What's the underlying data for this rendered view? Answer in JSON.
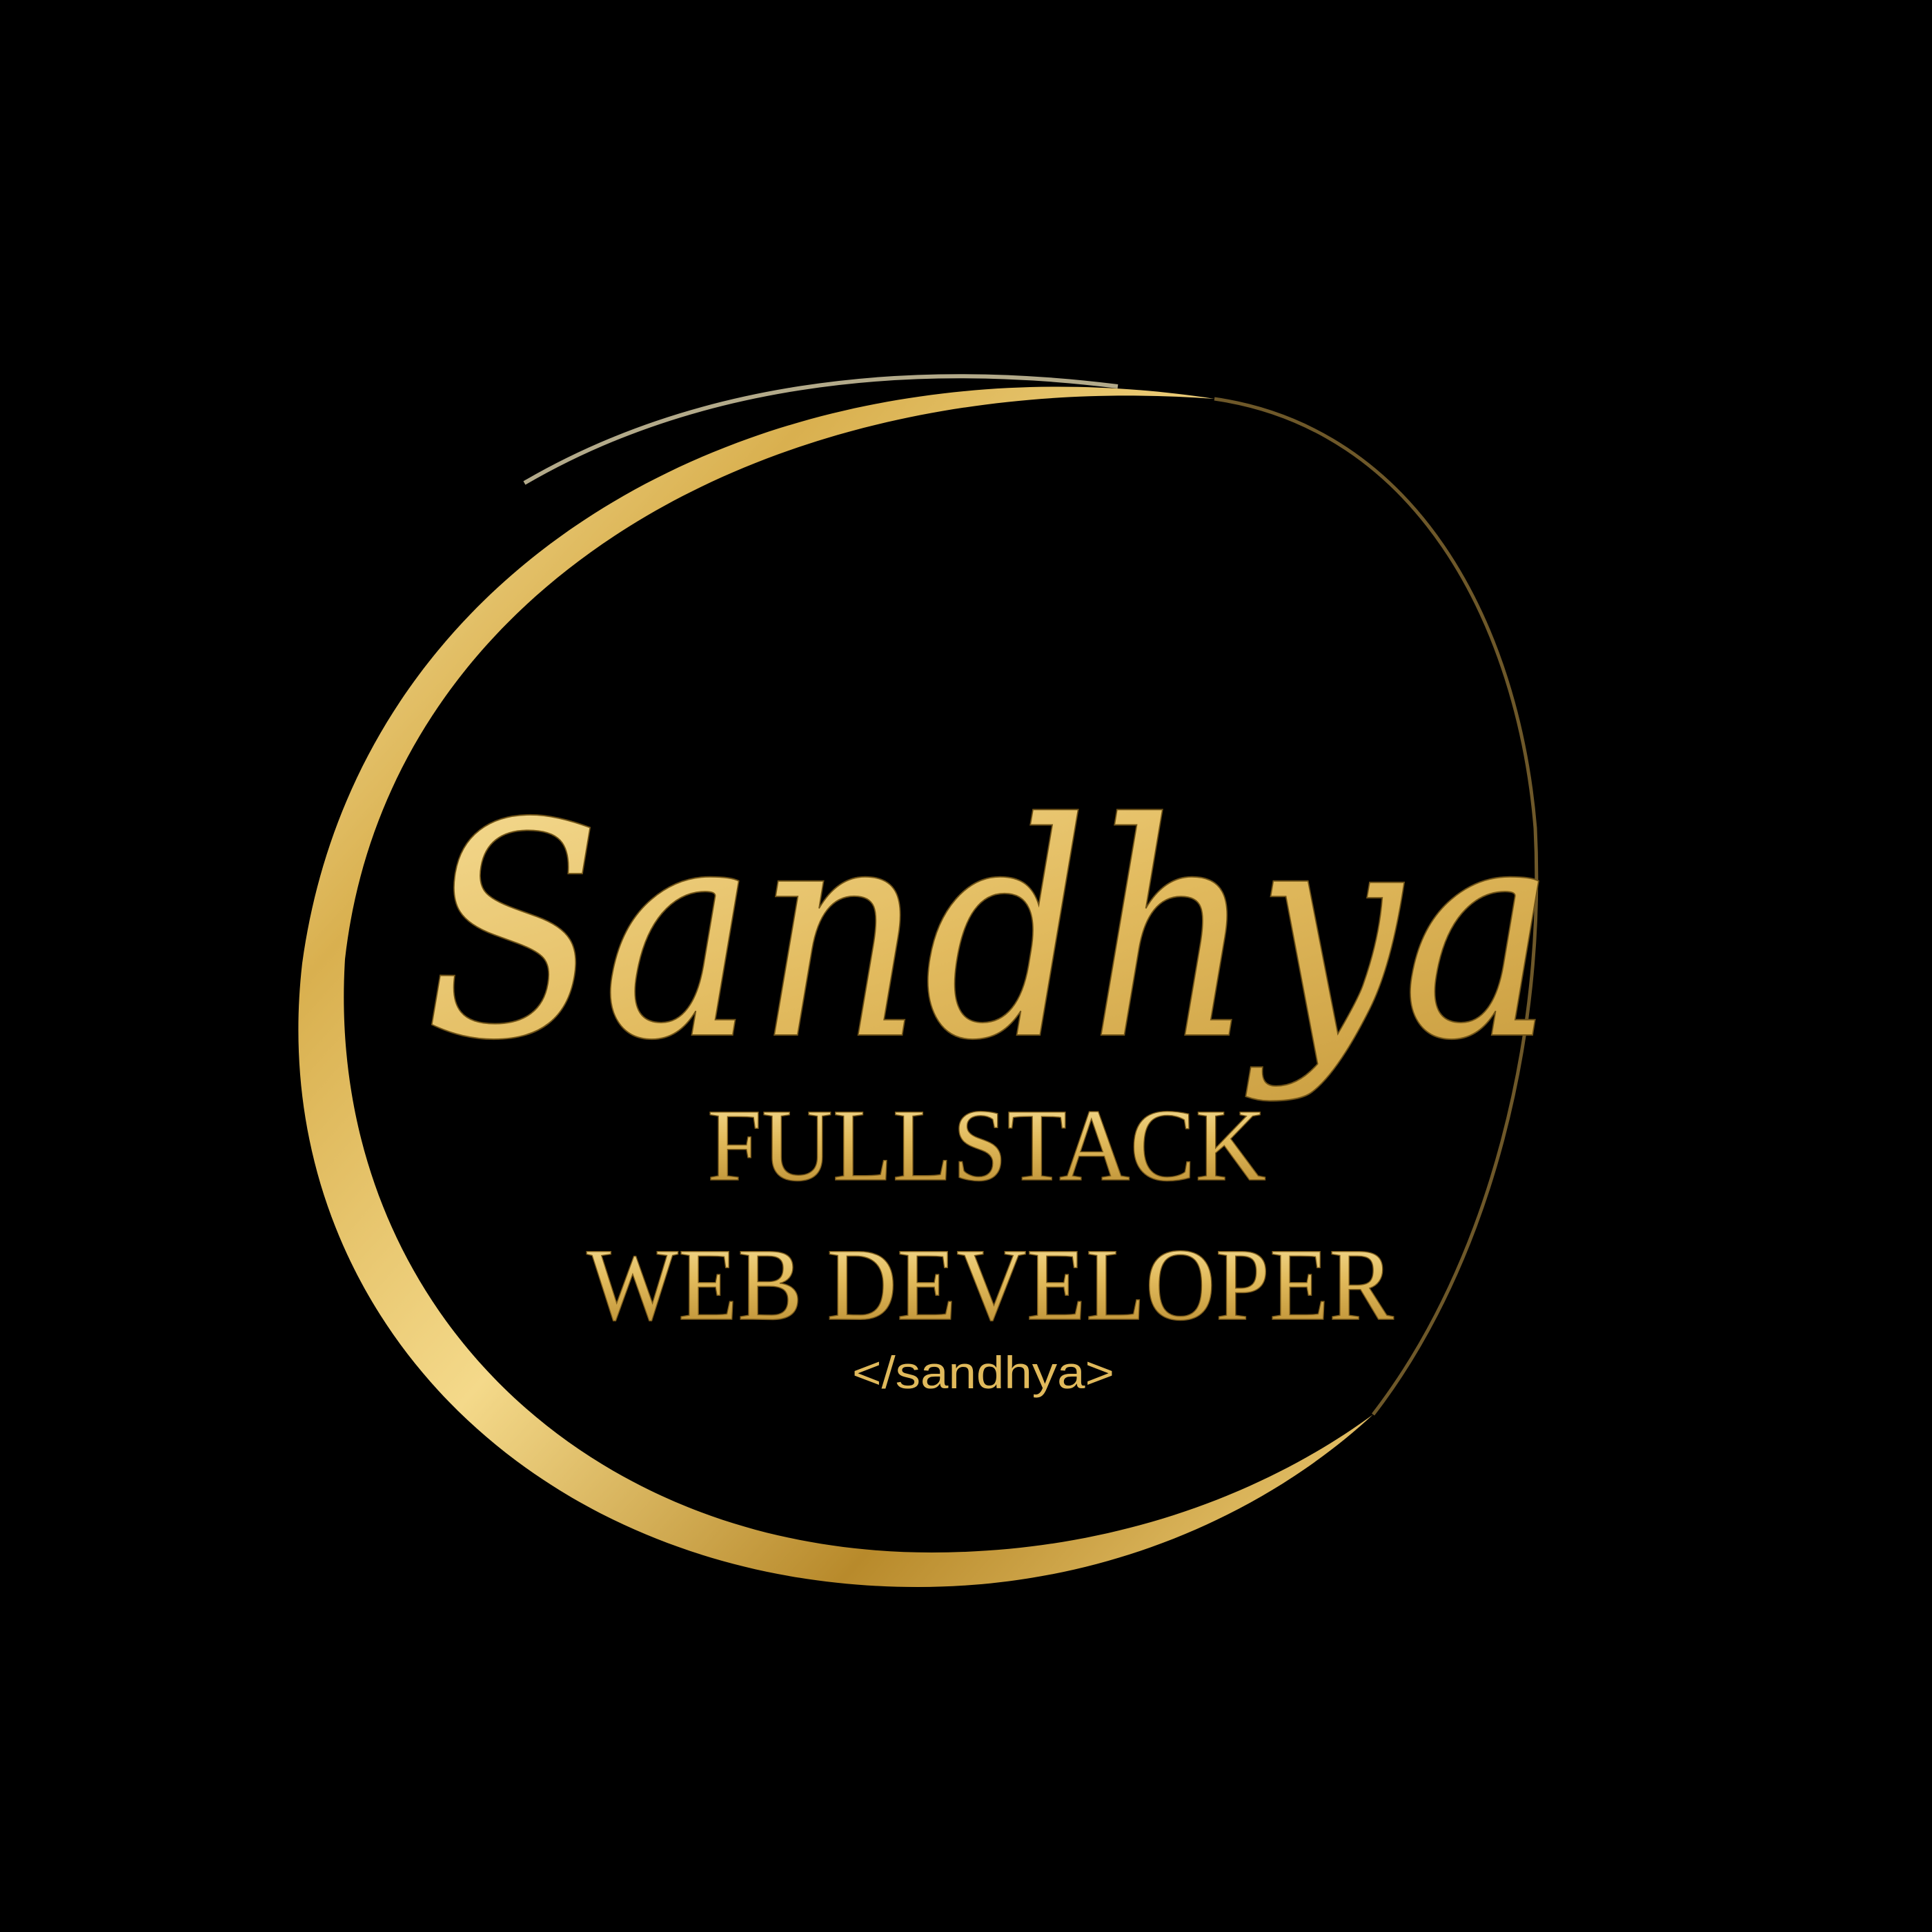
{
  "logo": {
    "script_name": "Sandhya",
    "title_line1": "FULLSTACK",
    "title_line2": "WEB DEVELOPER",
    "code_tag": "</sandhya>"
  },
  "colors": {
    "background": "#000000",
    "gold_light": "#f6dd8f",
    "gold_mid": "#d6ae4c",
    "gold_dark": "#8a6a1e"
  }
}
